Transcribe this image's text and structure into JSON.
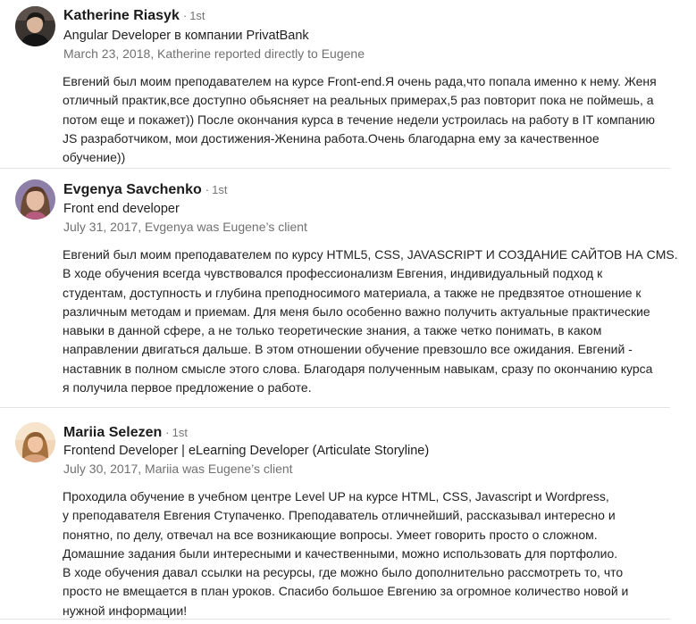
{
  "recommendations": [
    {
      "name": "Katherine Riasyk",
      "degree": "1st",
      "headline": "Angular Developer в компании PrivatBank",
      "meta": "March 23, 2018, Katherine reported directly to Eugene",
      "avatar_icon": "person-avatar-icon",
      "lines": [
        "Евгений был моим преподавателем на курсе Front-end.Я очень рада,что попала именно к нему. Женя",
        "отличный практик,все доступно обьясняет на реальных примерах,5 раз повторит пока не поймешь, а",
        "потом еще и покажет)) После окончания курса в течение недели устроилась на работу в IT компанию",
        "JS разработчиком, мои достижения-Женина работа.Очень благодарна ему за качественное",
        "обучение))"
      ]
    },
    {
      "name": "Evgenya Savchenko",
      "degree": "1st",
      "headline": "Front end developer",
      "meta": "July 31, 2017, Evgenya was Eugene’s client",
      "avatar_icon": "person-avatar-icon",
      "lines": [
        " Евгений был моим преподавателем по курсу HTML5, CSS, JAVASCRIPT И СОЗДАНИЕ САЙТОВ НА CMS.",
        "В ходе обучения всегда чувствовался профессионализм Евгения, индивидуальный подход к",
        "студентам, доступность и глубина преподносимого материала, а также не предвзятое отношение к",
        "различным методам и приемам. Для меня было особенно важно получить актуальные практические",
        "навыки в данной сфере, а не только теоретические знания, а также четко понимать, в каком",
        "направлении двигаться дальше. В этом отношении обучение превзошло все ожидания. Евгений -",
        "наставник в полном смысле этого слова. Благодаря полученным навыкам, сразу по окончанию курса",
        "я получила первое предложение о работе."
      ]
    },
    {
      "name": "Mariia Selezen",
      "degree": "1st",
      "headline": "Frontend Developer | eLearning Developer (Articulate Storyline)",
      "meta": "July 30, 2017, Mariia was Eugene’s client",
      "avatar_icon": "person-avatar-icon",
      "lines": [
        "Проходила обучение в учебном центре Level UP на курсе HTML, CSS, Javascript и Wordpress,",
        "у преподавателя Евгения Ступаченко. Преподаватель отличнейший, рассказывал интересно и",
        "понятно, по делу, отвечал на все возникающие вопросы. Умеет говорить просто о сложном.",
        "Домашние задания были интересными и качественными, можно использовать для портфолио.",
        "В ходе обучения давал ссылки на ресурсы, где можно было дополнительно рассмотреть то, что",
        "просто не вмещается в план уроков. Спасибо большое Евгению за огромное количество новой и",
        "нужной информации!"
      ]
    }
  ]
}
